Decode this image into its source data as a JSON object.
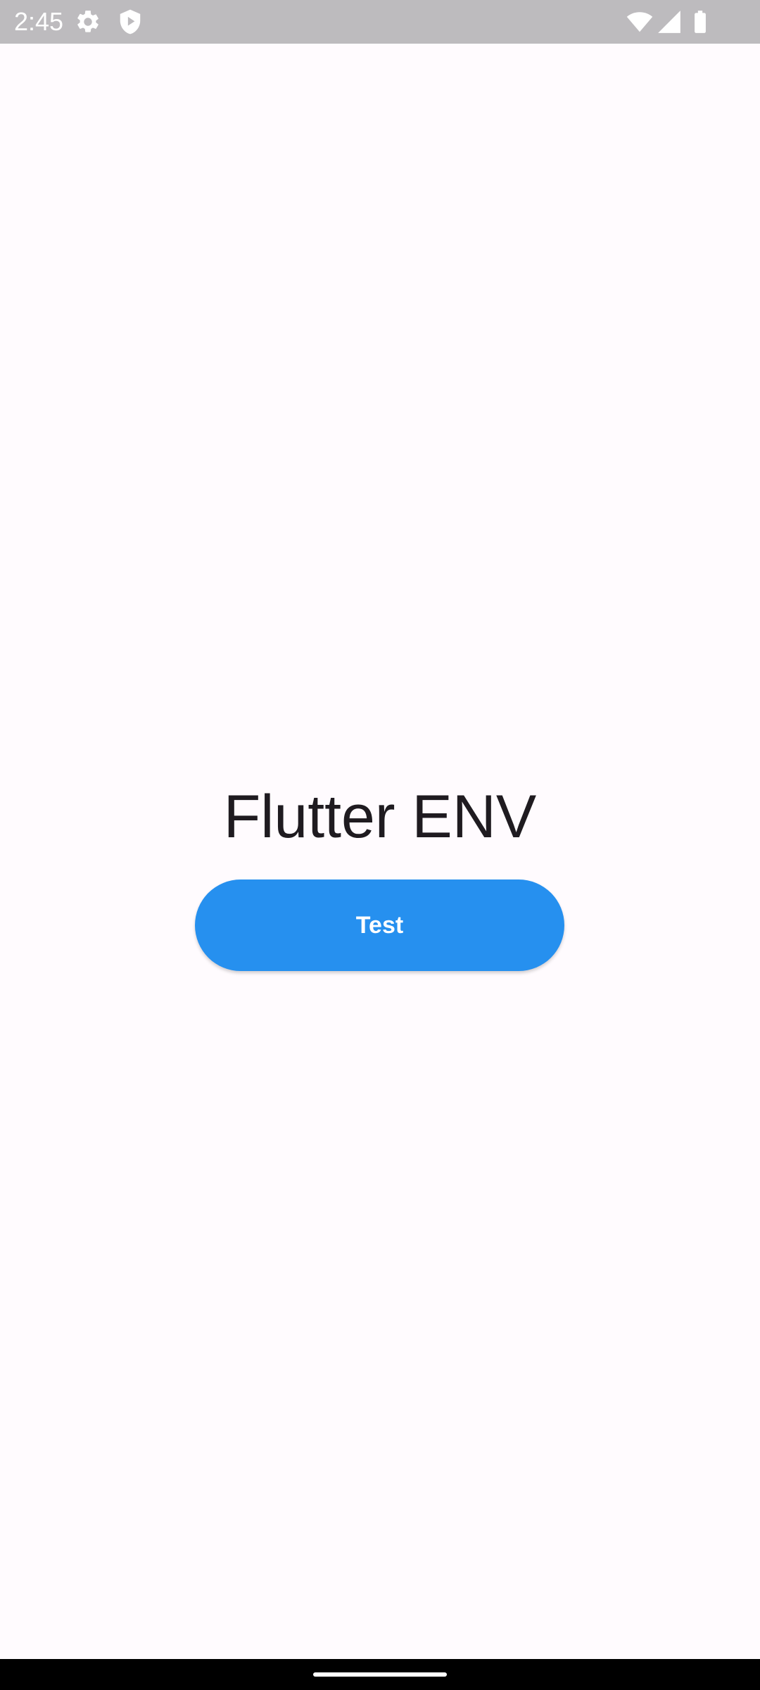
{
  "status_bar": {
    "time": "2:45",
    "left_icons": [
      "gear-icon",
      "shield-play-icon"
    ],
    "right_icons": [
      "wifi-icon",
      "cell-signal-icon",
      "battery-icon"
    ],
    "background_color": "#BDBBBE"
  },
  "main": {
    "title": "Flutter ENV",
    "button_label": "Test",
    "button_color": "#2690EF",
    "background_color": "#FFFBFE"
  },
  "nav_bar": {
    "background_color": "#000000"
  }
}
